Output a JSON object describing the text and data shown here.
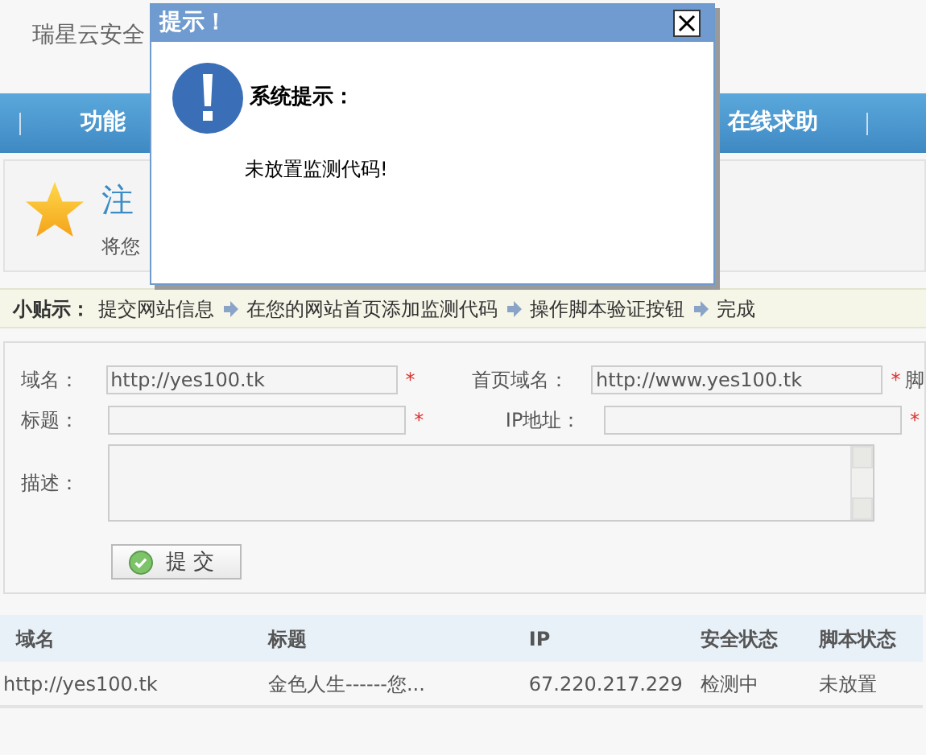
{
  "header": {
    "site_name": "瑞星云安全"
  },
  "nav": {
    "items": [
      {
        "label": "功能"
      },
      {
        "label": "在线求助"
      }
    ]
  },
  "banner": {
    "title": "注",
    "subtitle": "将您"
  },
  "tips": {
    "label": "小贴示：",
    "steps": [
      "提交网站信息",
      "在您的网站首页添加监测代码",
      "操作脚本验证按钮",
      "完成"
    ]
  },
  "form": {
    "rows": [
      {
        "fields": [
          {
            "label": "域名：",
            "value": "http://yes100.tk",
            "required_mark": "*"
          },
          {
            "label": "首页域名：",
            "value": "http://www.yes100.tk",
            "required_mark": "*"
          }
        ],
        "extra_label": "脚"
      },
      {
        "fields": [
          {
            "label": "标题：",
            "required_mark": "*"
          },
          {
            "label": "IP地址：",
            "required_mark": "*"
          }
        ]
      }
    ],
    "description": {
      "label": "描述："
    },
    "submit": "提交"
  },
  "table": {
    "columns": [
      "域名",
      "标题",
      "IP",
      "安全状态",
      "脚本状态"
    ],
    "rows": [
      [
        "http://yes100.tk",
        "金色人生------您...",
        "67.220.217.229",
        "检测中",
        "未放置"
      ]
    ]
  },
  "dialog": {
    "title": "提示！",
    "heading": "系统提示：",
    "message": "未放置监测代码!"
  }
}
